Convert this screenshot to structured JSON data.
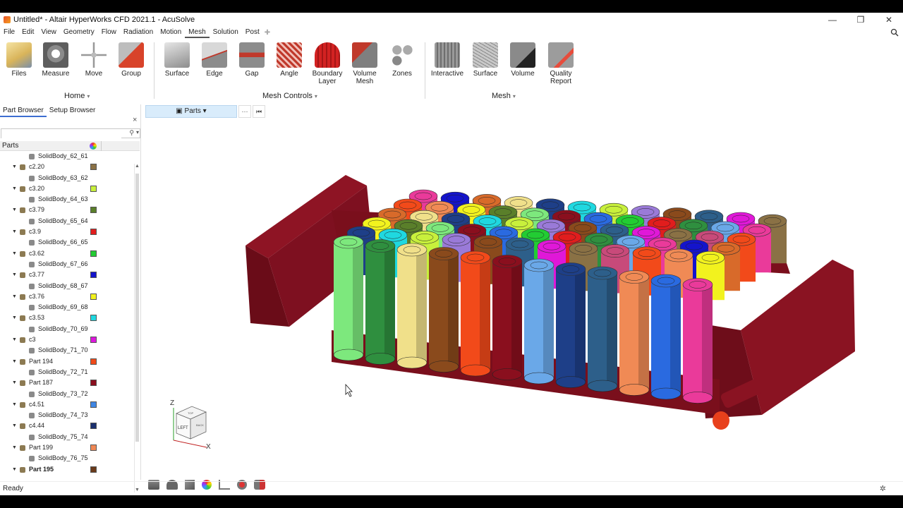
{
  "window": {
    "title": "Untitled* - Altair HyperWorks CFD 2021.1 - AcuSolve",
    "controls": [
      "—",
      "❐",
      "✕"
    ]
  },
  "menu": {
    "items": [
      "File",
      "Edit",
      "View",
      "Geometry",
      "Flow",
      "Radiation",
      "Motion",
      "Mesh",
      "Solution",
      "Post"
    ],
    "active": "Mesh",
    "plus": "✚"
  },
  "ribbon": {
    "tools": [
      {
        "label": "Files",
        "icon": "files-icon"
      },
      {
        "label": "Measure",
        "icon": "measure-icon"
      },
      {
        "label": "Move",
        "icon": "move-icon"
      },
      {
        "label": "Group",
        "icon": "group-icon"
      },
      {
        "label": "Surface",
        "icon": "surface-icon"
      },
      {
        "label": "Edge",
        "icon": "edge-icon"
      },
      {
        "label": "Gap",
        "icon": "gap-icon"
      },
      {
        "label": "Angle",
        "icon": "angle-icon"
      },
      {
        "label": "Boundary Layer",
        "icon": "boundary-layer-icon"
      },
      {
        "label": "Volume Mesh",
        "icon": "volume-mesh-icon"
      },
      {
        "label": "Zones",
        "icon": "zones-icon"
      },
      {
        "label": "Interactive",
        "icon": "interactive-icon"
      },
      {
        "label": "Surface",
        "icon": "surface-mesh-icon"
      },
      {
        "label": "Volume",
        "icon": "volume-icon"
      },
      {
        "label": "Quality Report",
        "icon": "quality-report-icon"
      }
    ],
    "groups": [
      "Home",
      "Mesh Controls",
      "Mesh"
    ],
    "caret": "▾"
  },
  "panel": {
    "tabs": [
      "Part Browser",
      "Setup Browser"
    ],
    "active_tab": "Part Browser",
    "close": "×",
    "search_placeholder": "",
    "search_icon": "🔍",
    "dropdown": "▾",
    "column_header": "Parts",
    "rows": [
      {
        "type": "body",
        "name": "SolidBody_62_61"
      },
      {
        "type": "part",
        "name": "c2.20",
        "color": "#8a7145"
      },
      {
        "type": "body",
        "name": "SolidBody_63_62"
      },
      {
        "type": "part",
        "name": "c3.20",
        "color": "#c8f03c"
      },
      {
        "type": "body",
        "name": "SolidBody_64_63"
      },
      {
        "type": "part",
        "name": "c3.79",
        "color": "#5a7f2a"
      },
      {
        "type": "body",
        "name": "SolidBody_65_64"
      },
      {
        "type": "part",
        "name": "c3.9",
        "color": "#e11d1d"
      },
      {
        "type": "body",
        "name": "SolidBody_66_65"
      },
      {
        "type": "part",
        "name": "c3.62",
        "color": "#22cc33"
      },
      {
        "type": "body",
        "name": "SolidBody_67_66"
      },
      {
        "type": "part",
        "name": "c3.77",
        "color": "#1414cc"
      },
      {
        "type": "body",
        "name": "SolidBody_68_67"
      },
      {
        "type": "part",
        "name": "c3.76",
        "color": "#f2f21e"
      },
      {
        "type": "body",
        "name": "SolidBody_69_68"
      },
      {
        "type": "part",
        "name": "c3.53",
        "color": "#20d8e0"
      },
      {
        "type": "body",
        "name": "SolidBody_70_69"
      },
      {
        "type": "part",
        "name": "c3",
        "color": "#dd18dd"
      },
      {
        "type": "body",
        "name": "SolidBody_71_70"
      },
      {
        "type": "part",
        "name": "Part 194",
        "color": "#f04a1a"
      },
      {
        "type": "body",
        "name": "SolidBody_72_71"
      },
      {
        "type": "part",
        "name": "Part 187",
        "color": "#8a0f1e"
      },
      {
        "type": "body",
        "name": "SolidBody_73_72"
      },
      {
        "type": "part",
        "name": "c4.51",
        "color": "#3f86e4"
      },
      {
        "type": "body",
        "name": "SolidBody_74_73"
      },
      {
        "type": "part",
        "name": "c4.44",
        "color": "#1a2f6e"
      },
      {
        "type": "body",
        "name": "SolidBody_75_74"
      },
      {
        "type": "part",
        "name": "Part 199",
        "color": "#f08855"
      },
      {
        "type": "body",
        "name": "SolidBody_76_75"
      },
      {
        "type": "part",
        "name": "Part 195",
        "color": "#6a3a1a",
        "bold": true
      }
    ]
  },
  "viewbar": {
    "parts_label": "Parts",
    "more": "···",
    "collapse": "⏮"
  },
  "viewport": {
    "axis_z": "Z",
    "axis_x": "X",
    "cube_front": "LEFT",
    "cube_top": "TOP",
    "cube_side": "BACK"
  },
  "status": {
    "text": "Ready"
  },
  "colors": {
    "frame": "#7a0f1c",
    "frame_dark": "#5a0a14",
    "accent": "#3d6ed1"
  }
}
